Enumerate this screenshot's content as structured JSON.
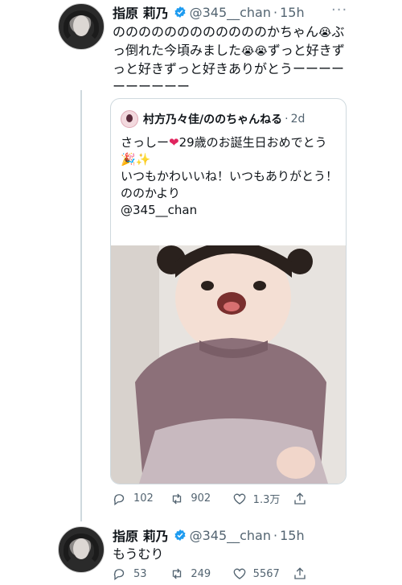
{
  "tweet1": {
    "name": "指原 莉乃",
    "handle": "@345__chan",
    "time": "15h",
    "text_parts": [
      "ののののののののののののかちゃん",
      "ぶっ倒れた今頃みました",
      "ずっと好きずっと好きずっと好きありがとうーーーーーーーーーー"
    ],
    "emoji": [
      "😭",
      "😭",
      "😭"
    ]
  },
  "quote": {
    "name": "村方乃々佳/ののちゃんねる",
    "time": "2d",
    "line1": "さっしー",
    "line1b": "29歳のお誕生日おめでとう",
    "line2": "いつもかわいいね！いつもありがとう！",
    "line3": "ののかより",
    "line4": "@345__chan",
    "emoji_heart": "❤",
    "emoji_party": "🎉✨"
  },
  "tweet1_actions": {
    "reply": "102",
    "retweet": "902",
    "like": "1.3万"
  },
  "tweet2": {
    "name": "指原 莉乃",
    "handle": "@345__chan",
    "time": "15h",
    "text": "もうむり"
  },
  "tweet2_actions": {
    "reply": "53",
    "retweet": "249",
    "like": "5567"
  },
  "colors": {
    "verified": "#1d9bf0",
    "text": "#0f1419",
    "muted": "#536471",
    "border": "#cfd9de"
  },
  "icons": [
    "verified-icon",
    "more-icon",
    "reply-icon",
    "retweet-icon",
    "like-icon",
    "share-icon"
  ]
}
